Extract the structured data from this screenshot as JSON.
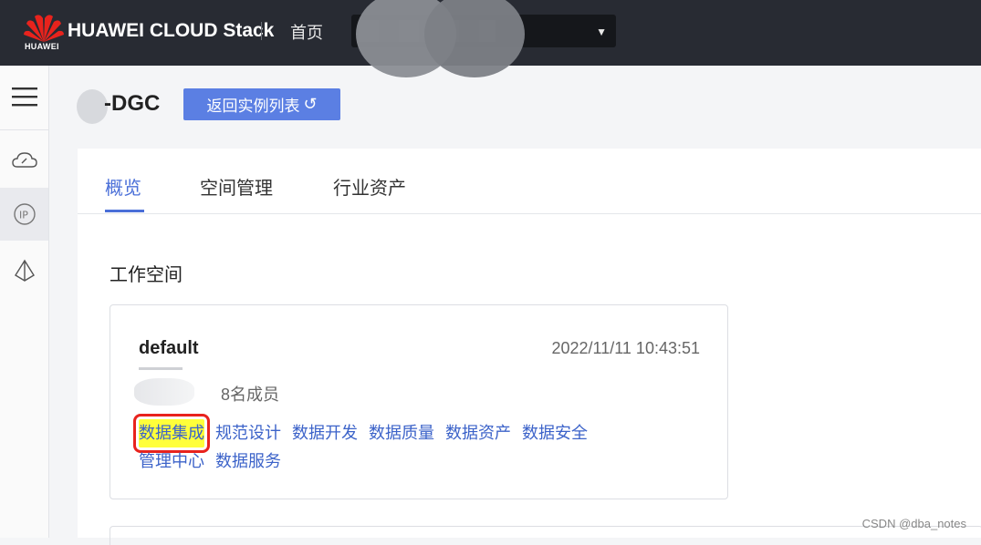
{
  "header": {
    "logo_sub": "HUAWEI",
    "brand": "HUAWEI CLOUD Stack",
    "home": "首页",
    "region_caret": "▼",
    "brand_color": "#e8231d"
  },
  "page": {
    "title": "-DGC",
    "back_button": "返回实例列表",
    "back_icon": "↺"
  },
  "tabs": [
    {
      "label": "概览",
      "active": true
    },
    {
      "label": "空间管理",
      "active": false
    },
    {
      "label": "行业资产",
      "active": false
    }
  ],
  "section": {
    "title": "工作空间"
  },
  "workspace": {
    "name": "default",
    "time": "2022/11/11 10:43:51",
    "members": "8名成员",
    "links": [
      "数据集成",
      "规范设计",
      "数据开发",
      "数据质量",
      "数据资产",
      "数据安全",
      "管理中心",
      "数据服务"
    ],
    "highlighted": "数据集成"
  },
  "watermark": "CSDN @dba_notes",
  "colors": {
    "accent": "#4a6fd8",
    "button": "#5b7fe3",
    "topbar": "#282b33",
    "highlight": "#ffff3a",
    "highlight_border": "#e8231d"
  }
}
